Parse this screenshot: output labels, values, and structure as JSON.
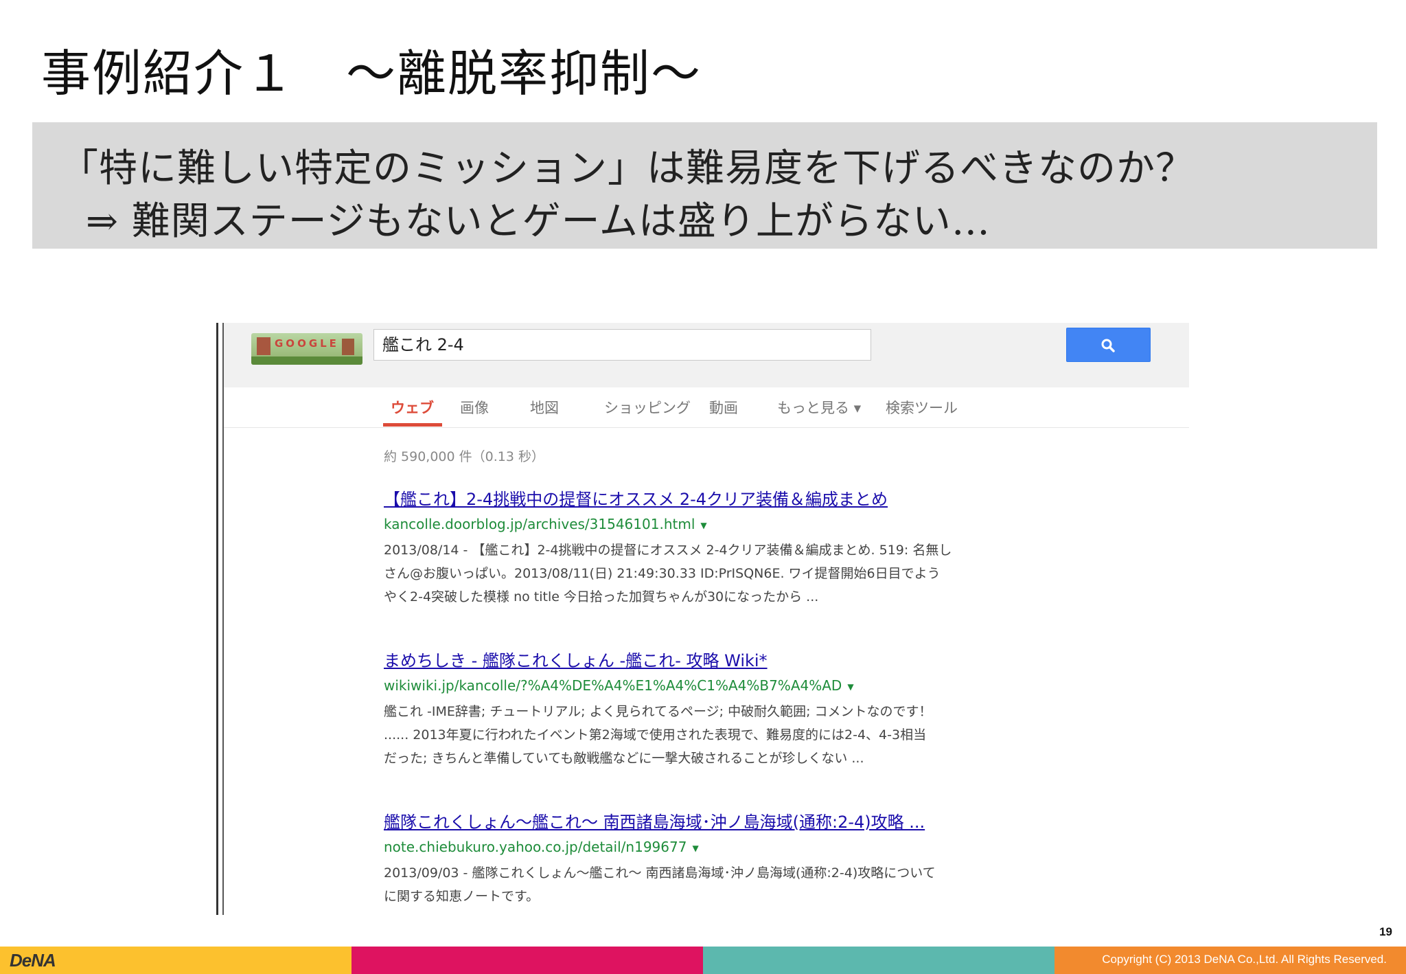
{
  "slide": {
    "title": "事例紹介１　～離脱率抑制～",
    "question_line1": "「特に難しい特定のミッション」は難易度を下げるべきなのか？",
    "question_line2": "⇒ 難関ステージもないとゲームは盛り上がらない…",
    "page_number": "19"
  },
  "search": {
    "logo_text": "GOOGLE",
    "query": "艦これ 2-4",
    "button_icon": "search-icon"
  },
  "tabs": [
    {
      "label": "ウェブ",
      "active": true
    },
    {
      "label": "画像",
      "active": false
    },
    {
      "label": "地図",
      "active": false
    },
    {
      "label": "ショッピング",
      "active": false
    },
    {
      "label": "動画",
      "active": false
    },
    {
      "label": "もっと見る ▾",
      "active": false
    },
    {
      "label": "検索ツール",
      "active": false
    }
  ],
  "result_stats": "約 590,000 件（0.13 秒）",
  "results": [
    {
      "title": "【艦これ】2-4挑戦中の提督にオススメ 2-4クリア装備＆編成まとめ",
      "url": "kancolle.doorblog.jp/archives/31546101.html",
      "snippet": [
        "2013/08/14 - 【艦これ】2-4挑戦中の提督にオススメ 2-4クリア装備＆編成まとめ. 519: 名無し",
        "さん@お腹いっぱい。2013/08/11(日) 21:49:30.33 ID:PrISQN6E. ワイ提督開始6日目でよう",
        "やく2-4突破した模様 no title 今日拾った加賀ちゃんが30になったから ..."
      ]
    },
    {
      "title": "まめちしき - 艦隊これくしょん -艦これ- 攻略 Wiki*",
      "url": "wikiwiki.jp/kancolle/?%A4%DE%A4%E1%A4%C1%A4%B7%A4%AD",
      "snippet": [
        "艦これ -IME辞書; チュートリアル; よく見られてるページ; 中破耐久範囲; コメントなのです！",
        "...... 2013年夏に行われたイベント第2海域で使用された表現で、難易度的には2-4、4-3相当",
        "だった; きちんと準備していても敵戦艦などに一撃大破されることが珍しくない ..."
      ]
    },
    {
      "title": "艦隊これくしょん～艦これ～ 南西諸島海域･沖ノ島海域(通称:2-4)攻略 ...",
      "url": "note.chiebukuro.yahoo.co.jp/detail/n199677",
      "snippet": [
        "2013/09/03 - 艦隊これくしょん～艦これ～ 南西諸島海域･沖ノ島海域(通称:2-4)攻略について",
        "に関する知恵ノートです。"
      ]
    }
  ],
  "footer": {
    "brand": "DeNA",
    "copyright": "Copyright (C) 2013 DeNA Co.,Ltd. All Rights Reserved."
  }
}
